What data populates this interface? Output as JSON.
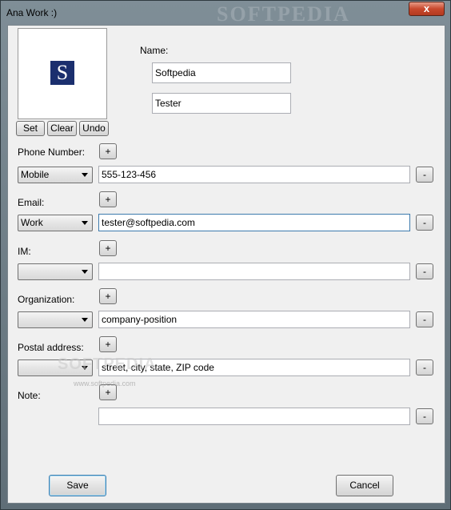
{
  "window": {
    "title": "Ana Work :)",
    "title_watermark": "SOFTPEDIA",
    "close_label": "x"
  },
  "photo": {
    "logo_letter": "S",
    "set_label": "Set",
    "clear_label": "Clear",
    "undo_label": "Undo"
  },
  "name": {
    "label": "Name:",
    "first": "Softpedia",
    "last": "Tester"
  },
  "phone": {
    "label": "Phone Number:",
    "type": "Mobile",
    "value": "555-123-456"
  },
  "email": {
    "label": "Email:",
    "type": "Work",
    "value": "tester@softpedia.com"
  },
  "im": {
    "label": "IM:",
    "type": "",
    "value": ""
  },
  "organization": {
    "label": "Organization:",
    "type": "",
    "value": "company-position"
  },
  "postal": {
    "label": "Postal address:",
    "type": "",
    "value": "street, city, state, ZIP code"
  },
  "note": {
    "label": "Note:",
    "value": ""
  },
  "buttons": {
    "plus": "+",
    "minus": "-",
    "save": "Save",
    "cancel": "Cancel"
  },
  "watermark": {
    "main": "SOFTPEDIA",
    "sub": "www.softpedia.com"
  }
}
